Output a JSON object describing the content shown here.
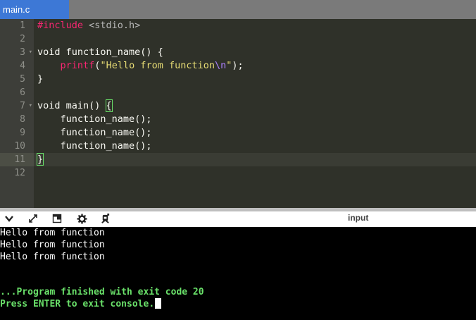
{
  "tab": {
    "label": "main.c"
  },
  "editor": {
    "lines": [
      {
        "n": "1",
        "fold": ""
      },
      {
        "n": "2",
        "fold": ""
      },
      {
        "n": "3",
        "fold": "▾"
      },
      {
        "n": "4",
        "fold": ""
      },
      {
        "n": "5",
        "fold": ""
      },
      {
        "n": "6",
        "fold": ""
      },
      {
        "n": "7",
        "fold": "▾"
      },
      {
        "n": "8",
        "fold": ""
      },
      {
        "n": "9",
        "fold": ""
      },
      {
        "n": "10",
        "fold": ""
      },
      {
        "n": "11",
        "fold": ""
      },
      {
        "n": "12",
        "fold": ""
      }
    ],
    "code": {
      "l1_directive": "#include",
      "l1_header": " <stdio.h>",
      "l3": "void function_name() {",
      "l4_indent": "    ",
      "l4_fn": "printf",
      "l4_open": "(",
      "l4_str": "\"Hello from function",
      "l4_esc": "\\n",
      "l4_strend": "\"",
      "l4_close": ");",
      "l5": "}",
      "l7_prefix": "void main() ",
      "l7_brace": "{",
      "l8": "    function_name();",
      "l9": "    function_name();",
      "l10": "    function_name();",
      "l11_brace": "}"
    }
  },
  "toolbar": {
    "icons": [
      "chevron-down-icon",
      "expand-icon",
      "layout-icon",
      "gear-icon",
      "debug-icon"
    ],
    "input_label": "input"
  },
  "console": {
    "output": [
      "Hello from function",
      "Hello from function",
      "Hello from function"
    ],
    "status_line": "...Program finished with exit code 20",
    "prompt_line": "Press ENTER to exit console."
  },
  "colors": {
    "tab_active": "#3d78d6",
    "editor_bg": "#2f3129",
    "console_status": "#6ae16a"
  }
}
